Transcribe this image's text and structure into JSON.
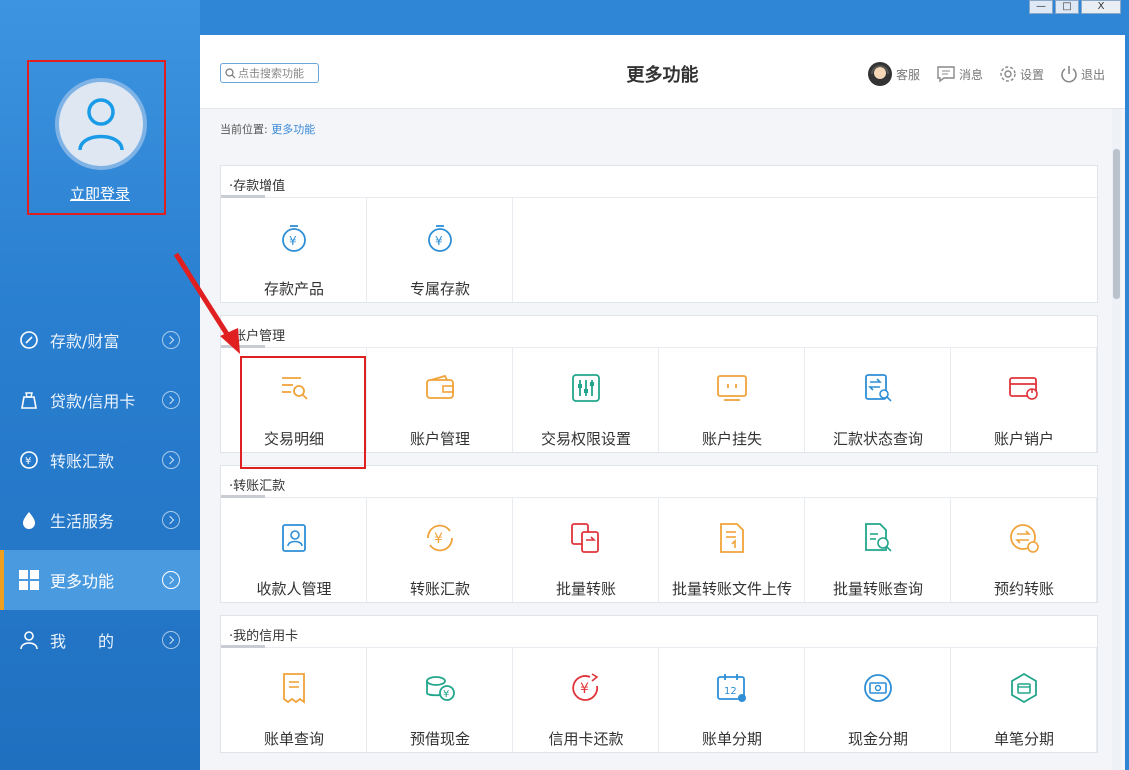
{
  "window": {
    "min": "—",
    "max": "□",
    "close": "X"
  },
  "sidebar": {
    "login_label": "立即登录",
    "items": [
      {
        "label": "存款/财富",
        "icon": "wealth-icon"
      },
      {
        "label": "贷款/信用卡",
        "icon": "loan-icon"
      },
      {
        "label": "转账汇款",
        "icon": "transfer-icon"
      },
      {
        "label": "生活服务",
        "icon": "life-service-icon"
      },
      {
        "label": "更多功能",
        "icon": "grid-icon",
        "active": true
      },
      {
        "label": "我　　的",
        "icon": "user-icon"
      }
    ]
  },
  "header": {
    "search_placeholder": "点击搜索功能",
    "title": "更多功能",
    "actions": {
      "service": "客服",
      "message": "消息",
      "settings": "设置",
      "logout": "退出"
    }
  },
  "breadcrumb": {
    "prefix": "当前位置:",
    "current": "更多功能"
  },
  "sections": [
    {
      "title": "·存款增值",
      "tiles": [
        {
          "label": "存款产品",
          "color": "#2e8fd6"
        },
        {
          "label": "专属存款",
          "color": "#2e8fd6"
        }
      ]
    },
    {
      "title": "·账户管理",
      "tiles": [
        {
          "label": "交易明细",
          "color": "#f0a33a"
        },
        {
          "label": "账户管理",
          "color": "#f0a33a"
        },
        {
          "label": "交易权限设置",
          "color": "#22a68b"
        },
        {
          "label": "账户挂失",
          "color": "#f0a33a"
        },
        {
          "label": "汇款状态查询",
          "color": "#2e8fd6"
        },
        {
          "label": "账户销户",
          "color": "#e0343a"
        }
      ]
    },
    {
      "title": "·转账汇款",
      "tiles": [
        {
          "label": "收款人管理",
          "color": "#2e8fd6"
        },
        {
          "label": "转账汇款",
          "color": "#f0a33a"
        },
        {
          "label": "批量转账",
          "color": "#e0343a"
        },
        {
          "label": "批量转账文件上传",
          "color": "#f0a33a"
        },
        {
          "label": "批量转账查询",
          "color": "#22a68b"
        },
        {
          "label": "预约转账",
          "color": "#f0a33a"
        }
      ]
    },
    {
      "title": "·我的信用卡",
      "tiles": [
        {
          "label": "账单查询",
          "color": "#f0a33a"
        },
        {
          "label": "预借现金",
          "color": "#22a68b"
        },
        {
          "label": "信用卡还款",
          "color": "#e0343a"
        },
        {
          "label": "账单分期",
          "color": "#2e8fd6"
        },
        {
          "label": "现金分期",
          "color": "#2e8fd6"
        },
        {
          "label": "单笔分期",
          "color": "#22a68b"
        }
      ]
    }
  ]
}
